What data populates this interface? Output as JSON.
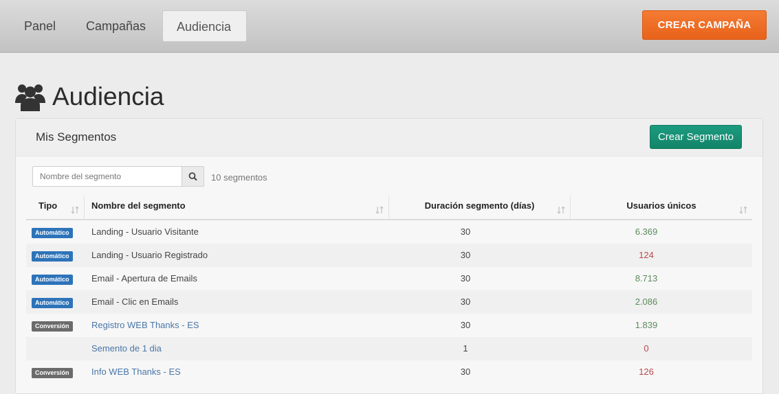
{
  "nav": {
    "items": [
      {
        "label": "Panel"
      },
      {
        "label": "Campañas"
      },
      {
        "label": "Audiencia"
      }
    ],
    "create_campaign": "CREAR CAMPAÑA"
  },
  "page": {
    "title": "Audiencia",
    "icon": "users-icon"
  },
  "panel": {
    "title": "Mis Segmentos",
    "create_segment": "Crear Segmento",
    "search": {
      "placeholder": "Nombre del segmento",
      "value": ""
    },
    "count": "10 segmentos"
  },
  "table": {
    "headers": {
      "tipo": "Tipo",
      "nombre": "Nombre del segmento",
      "duracion": "Duración segmento (días)",
      "usuarios": "Usuarios únicos"
    },
    "rows": [
      {
        "tipo": "Automático",
        "nombre": "Landing - Usuario Visitante",
        "duracion": "30",
        "usuarios": "6.369"
      },
      {
        "tipo": "Automático",
        "nombre": "Landing - Usuario Registrado",
        "duracion": "30",
        "usuarios": "124"
      },
      {
        "tipo": "Automático",
        "nombre": "Email - Apertura de Emails",
        "duracion": "30",
        "usuarios": "8.713"
      },
      {
        "tipo": "Automático",
        "nombre": "Email - Clic en Emails",
        "duracion": "30",
        "usuarios": "2.086"
      },
      {
        "tipo": "Conversión",
        "nombre": "Registro WEB Thanks - ES",
        "duracion": "30",
        "usuarios": "1.839"
      },
      {
        "tipo": "",
        "nombre": "Semento de 1 dia",
        "duracion": "1",
        "usuarios": "0"
      },
      {
        "tipo": "Conversión",
        "nombre": "Info WEB Thanks - ES",
        "duracion": "30",
        "usuarios": "126"
      }
    ]
  },
  "colors": {
    "accent_orange": "#e8621a",
    "accent_green": "#138468",
    "badge_auto": "#2d73b9",
    "badge_conv": "#6b6b6b",
    "link": "#4a76a8",
    "value_positive": "#5b8a5b",
    "value_negative": "#b8484c"
  }
}
